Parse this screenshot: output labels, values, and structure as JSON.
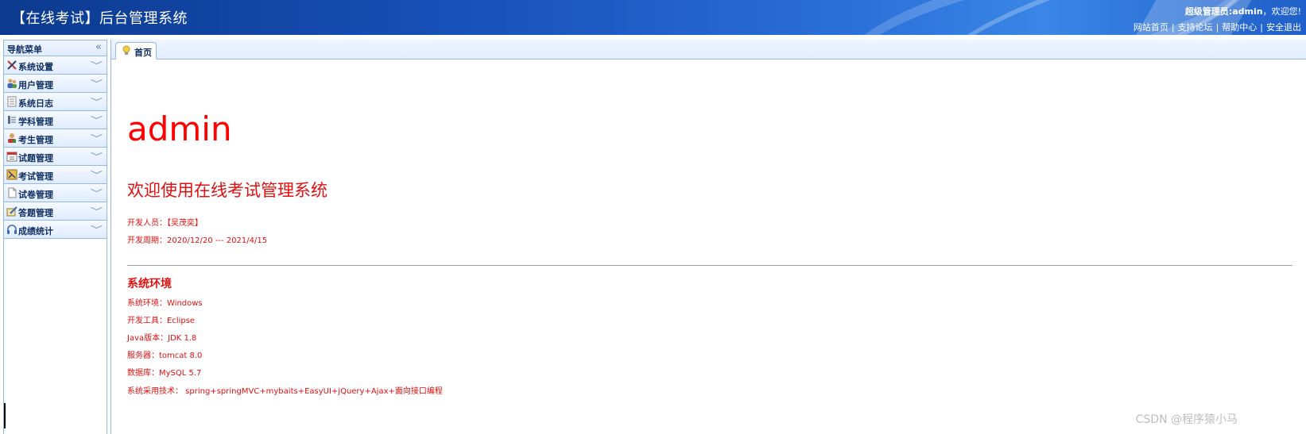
{
  "header": {
    "title": "【在线考试】后台管理系统",
    "welcome_role": "超级管理员:admin",
    "welcome_suffix": "，欢迎您!",
    "links": [
      "网站首页",
      "支持论坛",
      "帮助中心",
      "安全退出"
    ]
  },
  "sidebar": {
    "title": "导航菜单",
    "items": [
      {
        "label": "系统设置",
        "icon": "tools-icon"
      },
      {
        "label": "用户管理",
        "icon": "users-icon"
      },
      {
        "label": "系统日志",
        "icon": "log-icon"
      },
      {
        "label": "学科管理",
        "icon": "subject-icon"
      },
      {
        "label": "考生管理",
        "icon": "students-icon"
      },
      {
        "label": "试题管理",
        "icon": "calendar-icon"
      },
      {
        "label": "考试管理",
        "icon": "exam-icon"
      },
      {
        "label": "试卷管理",
        "icon": "paper-icon"
      },
      {
        "label": "答题管理",
        "icon": "answer-icon"
      },
      {
        "label": "成绩统计",
        "icon": "headset-icon"
      }
    ]
  },
  "tabs": [
    {
      "label": "首页",
      "icon": "lightbulb-icon",
      "active": true
    }
  ],
  "content": {
    "username": "admin",
    "welcome": "欢迎使用在线考试管理系统",
    "developer": "开发人员：【吴茂奕】",
    "period": "开发周期：2020/12/20 --- 2021/4/15",
    "env_heading": "系统环境",
    "env_lines": [
      "系统环境：Windows",
      "开发工具：Eclipse",
      "Java版本：JDK 1.8",
      "服务器：tomcat 8.0",
      "数据库：MySQL 5.7",
      "系统采用技术： spring+springMVC+mybaits+EasyUI+jQuery+Ajax+面向接口编程"
    ]
  },
  "watermark": "CSDN @程序猿小马",
  "colors": {
    "header_bg": "#1750b8",
    "accent_red": "#e01010",
    "border_blue": "#95b8e7"
  }
}
